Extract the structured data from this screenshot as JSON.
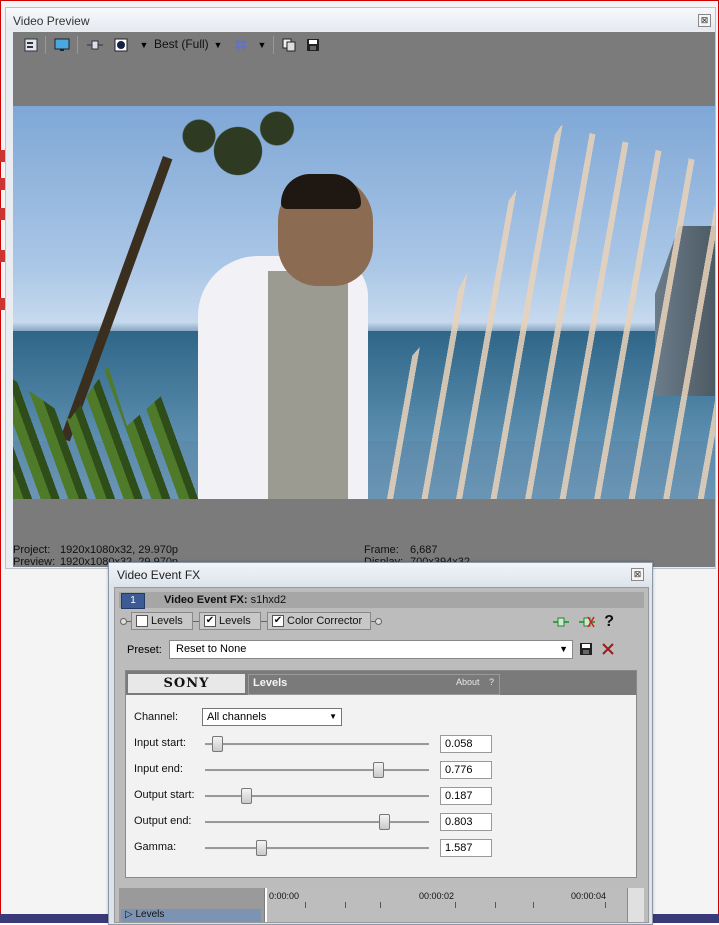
{
  "video_preview": {
    "title": "Video Preview",
    "close_glyph": "⊠",
    "quality": "Best (Full)",
    "status": {
      "project_label": "Project:",
      "project_value": "1920x1080x32, 29.970p",
      "preview_label": "Preview:",
      "preview_value": "1920x1080x32, 29.970p",
      "frame_label": "Frame:",
      "frame_value": "6,687",
      "display_label": "Display:",
      "display_value": "700x394x32"
    }
  },
  "fx_window": {
    "title": "Video Event FX",
    "close_glyph": "⊠",
    "header_number": "1",
    "header_label": "Video Event FX:",
    "header_value": "s1hxd2",
    "chain": [
      {
        "label": "Levels",
        "checked": false,
        "check_glyph": ""
      },
      {
        "label": "Levels",
        "checked": true,
        "check_glyph": "✔"
      },
      {
        "label": "Color Corrector",
        "checked": true,
        "check_glyph": "✔"
      }
    ],
    "help_glyph": "?",
    "preset_label": "Preset:",
    "preset_value": "Reset to None",
    "plugin_panel": {
      "brand": "SONY",
      "name": "Levels",
      "about": "About",
      "about_q": "?",
      "channel_label": "Channel:",
      "channel_value": "All channels",
      "params": [
        {
          "label": "Input start:",
          "value": "0.058",
          "level": 0.058
        },
        {
          "label": "Input end:",
          "value": "0.776",
          "level": 0.776
        },
        {
          "label": "Output start:",
          "value": "0.187",
          "level": 0.187
        },
        {
          "label": "Output end:",
          "value": "0.803",
          "level": 0.803
        },
        {
          "label": "Gamma:",
          "value": "1.587",
          "level": 0.25
        }
      ]
    },
    "timeline": {
      "track_label": "Levels",
      "times": [
        "0:00:00",
        "00:00:02",
        "00:00:04"
      ]
    }
  },
  "colors": {
    "accent_red": "#d40000",
    "panel_gray": "#7b7b7b",
    "header_blue": "#3c5a94"
  }
}
